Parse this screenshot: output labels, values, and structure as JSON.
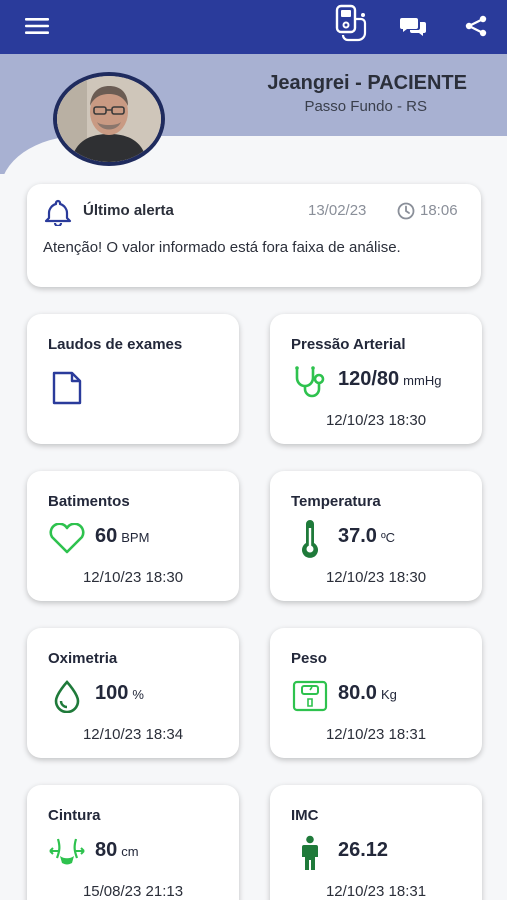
{
  "topbar": {
    "menu_icon": "hamburger-menu-icon",
    "device_icon": "blood-pressure-monitor-icon",
    "chat_icon": "chat-bubbles-icon",
    "share_icon": "share-icon"
  },
  "patient": {
    "name": "Jeangrei - PACIENTE",
    "city": "Passo Fundo - RS"
  },
  "alert": {
    "title": "Último alerta",
    "date": "13/02/23",
    "time": "18:06",
    "message": "Atenção! O valor informado está fora faixa de análise."
  },
  "tiles": {
    "exams": {
      "title": "Laudos de exames"
    },
    "pressure": {
      "title": "Pressão Arterial",
      "value": "120/80",
      "unit": "mmHg",
      "date": "12/10/23 18:30"
    },
    "heart": {
      "title": "Batimentos",
      "value": "60",
      "unit": "BPM",
      "date": "12/10/23 18:30"
    },
    "temperature": {
      "title": "Temperatura",
      "value": "37.0",
      "unit": "ºC",
      "date": "12/10/23 18:30"
    },
    "oximetry": {
      "title": "Oximetria",
      "value": "100",
      "unit": "%",
      "date": "12/10/23 18:34"
    },
    "weight": {
      "title": "Peso",
      "value": "80.0",
      "unit": "Kg",
      "date": "12/10/23 18:31"
    },
    "waist": {
      "title": "Cintura",
      "value": "80",
      "unit": "cm",
      "date": "15/08/23 21:13"
    },
    "bmi": {
      "title": "IMC",
      "value": "26.12",
      "unit": "",
      "date": "12/10/23 18:31"
    }
  },
  "colors": {
    "primary": "#2a3b9b",
    "header_band": "#a8b1d2",
    "accent_green": "#2ec24e",
    "dark_green": "#1f7a3a"
  }
}
